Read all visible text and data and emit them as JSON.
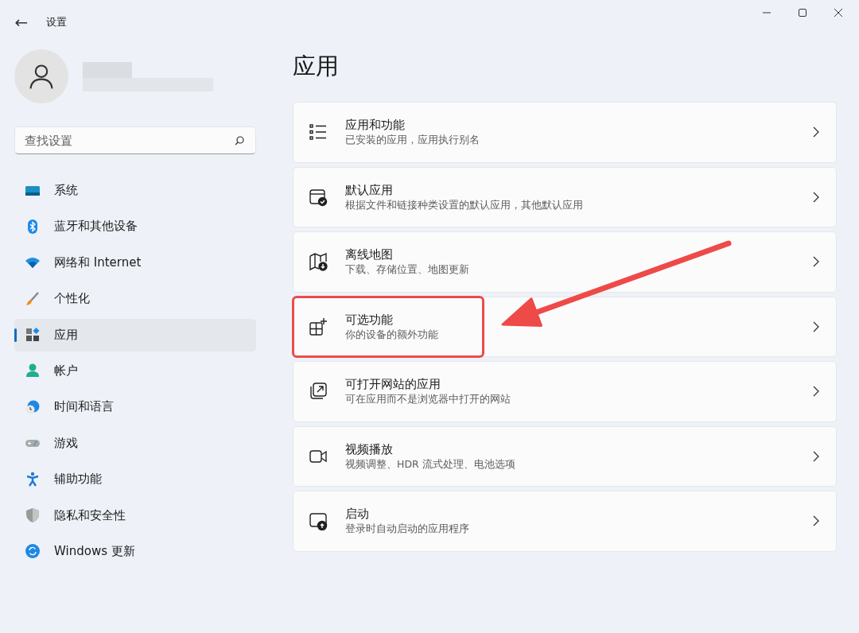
{
  "window": {
    "title": "设置",
    "back_button": "←"
  },
  "search": {
    "placeholder": "查找设置"
  },
  "sidebar": {
    "items": [
      {
        "label": "系统",
        "kind": "system",
        "selected": false
      },
      {
        "label": "蓝牙和其他设备",
        "kind": "bluetooth",
        "selected": false
      },
      {
        "label": "网络和 Internet",
        "kind": "network",
        "selected": false
      },
      {
        "label": "个性化",
        "kind": "brush",
        "selected": false
      },
      {
        "label": "应用",
        "kind": "apps",
        "selected": true
      },
      {
        "label": "帐户",
        "kind": "account",
        "selected": false
      },
      {
        "label": "时间和语言",
        "kind": "time",
        "selected": false
      },
      {
        "label": "游戏",
        "kind": "game",
        "selected": false
      },
      {
        "label": "辅助功能",
        "kind": "access",
        "selected": false
      },
      {
        "label": "隐私和安全性",
        "kind": "shield",
        "selected": false
      },
      {
        "label": "Windows 更新",
        "kind": "update",
        "selected": false
      }
    ]
  },
  "page": {
    "title": "应用",
    "cards": [
      {
        "title": "应用和功能",
        "subtitle": "已安装的应用，应用执行别名",
        "kind": "list",
        "highlighted": false
      },
      {
        "title": "默认应用",
        "subtitle": "根据文件和链接种类设置的默认应用，其他默认应用",
        "kind": "default",
        "highlighted": false
      },
      {
        "title": "离线地图",
        "subtitle": "下载、存储位置、地图更新",
        "kind": "map",
        "highlighted": false
      },
      {
        "title": "可选功能",
        "subtitle": "你的设备的额外功能",
        "kind": "optional",
        "highlighted": true
      },
      {
        "title": "可打开网站的应用",
        "subtitle": "可在应用而不是浏览器中打开的网站",
        "kind": "web",
        "highlighted": false
      },
      {
        "title": "视频播放",
        "subtitle": "视频调整、HDR 流式处理、电池选项",
        "kind": "video",
        "highlighted": false
      },
      {
        "title": "启动",
        "subtitle": "登录时自动启动的应用程序",
        "kind": "startup",
        "highlighted": false
      }
    ]
  }
}
